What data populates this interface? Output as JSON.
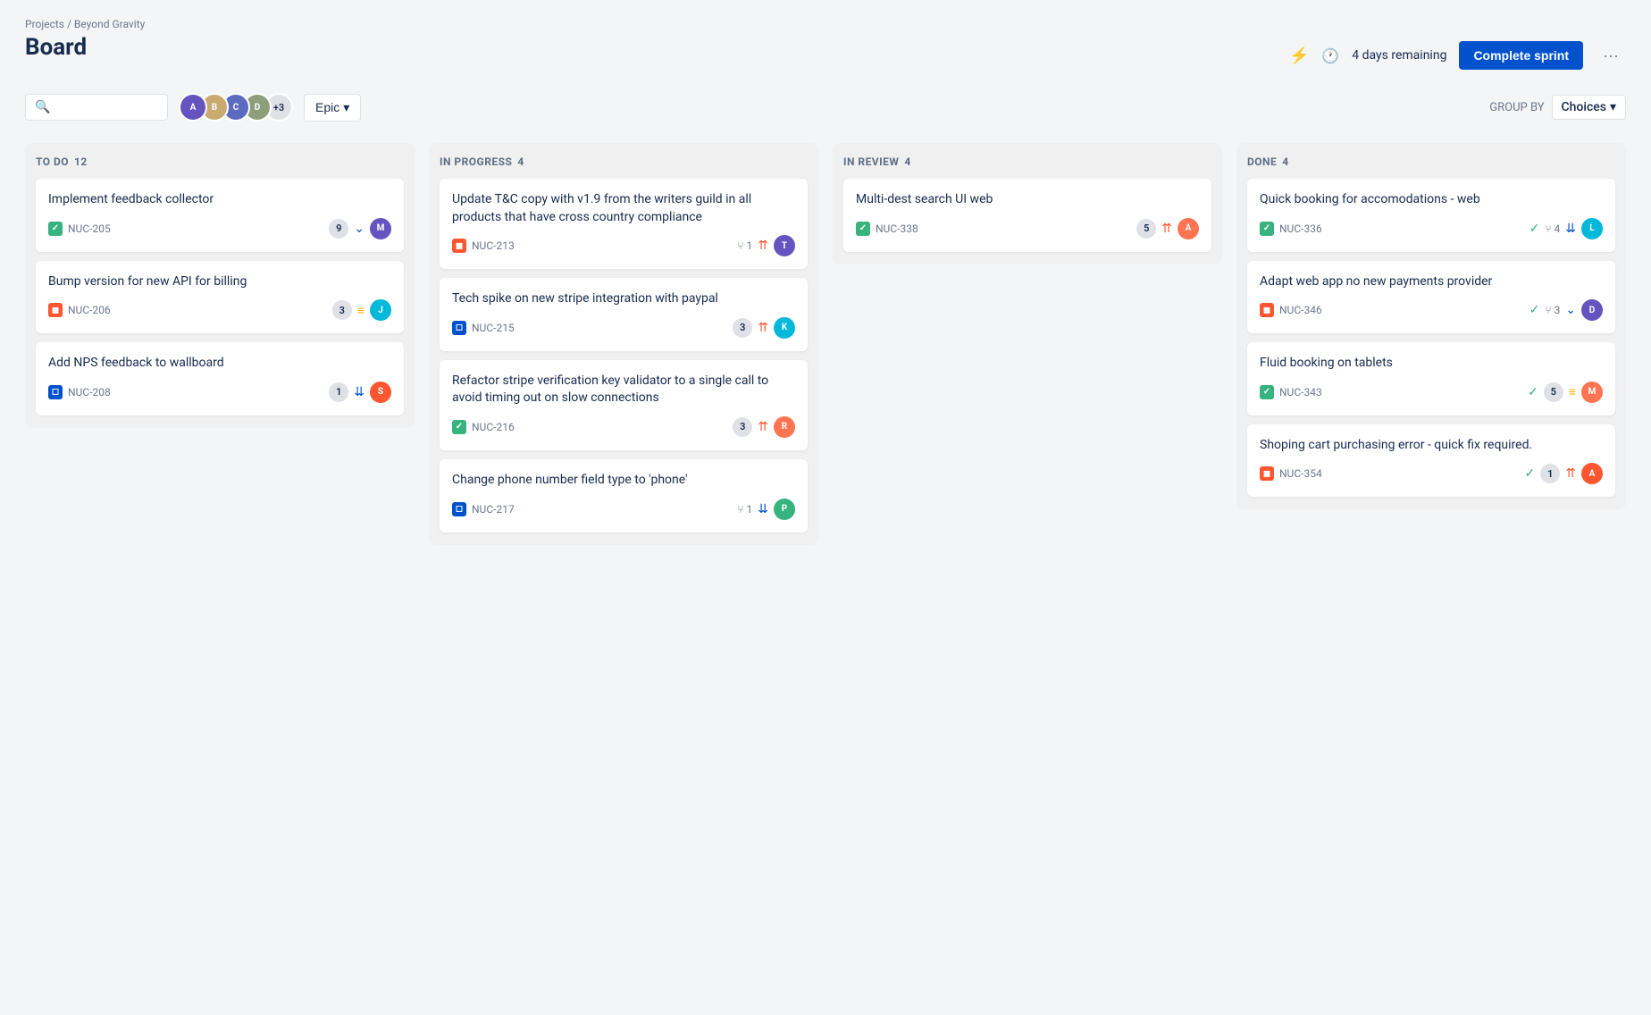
{
  "breadcrumb": "Projects / Beyond Gravity",
  "page_title": "Board",
  "search_placeholder": "",
  "avatars": [
    {
      "id": "av1",
      "initials": "A",
      "color": "#6554c0"
    },
    {
      "id": "av2",
      "initials": "B",
      "color": "#00b8d9"
    },
    {
      "id": "av3",
      "initials": "C",
      "color": "#ff7452"
    },
    {
      "id": "av4",
      "initials": "D",
      "color": "#36b37e"
    },
    {
      "id": "av5",
      "initials": "+3",
      "color": "#dfe1e6",
      "text_color": "#172b4d"
    }
  ],
  "epic_label": "Epic",
  "header": {
    "lightning_label": "",
    "days_remaining": "4 days remaining",
    "complete_sprint": "Complete sprint",
    "more": "···"
  },
  "group_by_label": "GROUP BY",
  "choices_label": "Choices",
  "columns": [
    {
      "id": "todo",
      "title": "TO DO",
      "count": "12",
      "cards": [
        {
          "id": "card-205",
          "title": "Implement feedback collector",
          "issue_type": "story",
          "issue_id": "NUC-205",
          "points": "9",
          "priority": "down",
          "priority_type": "low",
          "has_avatar": true,
          "avatar_color": "#6554c0",
          "avatar_initials": "M"
        },
        {
          "id": "card-206",
          "title": "Bump version for new API for billing",
          "issue_type": "bug",
          "issue_id": "NUC-206",
          "points": "3",
          "priority": "medium",
          "priority_type": "medium",
          "has_avatar": true,
          "avatar_color": "#00b8d9",
          "avatar_initials": "J"
        },
        {
          "id": "card-208",
          "title": "Add NPS feedback to wallboard",
          "issue_type": "task",
          "issue_id": "NUC-208",
          "points": "1",
          "priority": "double-down",
          "priority_type": "low2",
          "has_avatar": true,
          "avatar_color": "#ff5630",
          "avatar_initials": "S"
        }
      ]
    },
    {
      "id": "inprogress",
      "title": "IN PROGRESS",
      "count": "4",
      "cards": [
        {
          "id": "card-213",
          "title": "Update T&C copy with v1.9 from the writers guild in all products that have cross country compliance",
          "issue_type": "bug",
          "issue_id": "NUC-213",
          "has_pr": true,
          "pr_count": "1",
          "points": null,
          "priority": "high",
          "priority_type": "high",
          "has_avatar": true,
          "avatar_color": "#6554c0",
          "avatar_initials": "T"
        },
        {
          "id": "card-215",
          "title": "Tech spike on new stripe integration with paypal",
          "issue_type": "task",
          "issue_id": "NUC-215",
          "points": "3",
          "priority": "high",
          "priority_type": "high",
          "has_avatar": true,
          "avatar_color": "#00b8d9",
          "avatar_initials": "K"
        },
        {
          "id": "card-216",
          "title": "Refactor stripe verification key validator to a single call to avoid timing out on slow connections",
          "issue_type": "story",
          "issue_id": "NUC-216",
          "points": "3",
          "priority": "high",
          "priority_type": "high",
          "has_avatar": true,
          "avatar_color": "#ff7452",
          "avatar_initials": "R"
        },
        {
          "id": "card-217",
          "title": "Change phone number field type to 'phone'",
          "issue_type": "task",
          "issue_id": "NUC-217",
          "has_pr": true,
          "pr_count": "1",
          "points": null,
          "priority": "double-down",
          "priority_type": "low2",
          "has_avatar": true,
          "avatar_color": "#36b37e",
          "avatar_initials": "P"
        }
      ]
    },
    {
      "id": "inreview",
      "title": "IN REVIEW",
      "count": "4",
      "cards": [
        {
          "id": "card-338",
          "title": "Multi-dest search UI web",
          "issue_type": "story",
          "issue_id": "NUC-338",
          "points": "5",
          "priority": "high",
          "priority_type": "high",
          "has_avatar": true,
          "avatar_color": "#ff7452",
          "avatar_initials": "A"
        }
      ]
    },
    {
      "id": "done",
      "title": "DONE",
      "count": "4",
      "cards": [
        {
          "id": "card-336",
          "title": "Quick booking for accomodations - web",
          "issue_type": "story",
          "issue_id": "NUC-336",
          "has_check": true,
          "has_pr": true,
          "pr_count": "4",
          "points": null,
          "priority": "double-down",
          "priority_type": "low2",
          "has_avatar": true,
          "avatar_color": "#00b8d9",
          "avatar_initials": "L"
        },
        {
          "id": "card-346",
          "title": "Adapt web app no new payments provider",
          "issue_type": "bug",
          "issue_id": "NUC-346",
          "has_check": true,
          "has_pr": true,
          "pr_count": "3",
          "points": null,
          "priority": "down",
          "priority_type": "low",
          "has_avatar": true,
          "avatar_color": "#6554c0",
          "avatar_initials": "D"
        },
        {
          "id": "card-343",
          "title": "Fluid booking on tablets",
          "issue_type": "story",
          "issue_id": "NUC-343",
          "has_check": true,
          "points": "5",
          "priority": "medium",
          "priority_type": "medium",
          "has_avatar": true,
          "avatar_color": "#ff7452",
          "avatar_initials": "M"
        },
        {
          "id": "card-354",
          "title": "Shoping cart purchasing error - quick fix required.",
          "issue_type": "bug",
          "issue_id": "NUC-354",
          "has_check": true,
          "points": "1",
          "priority": "high",
          "priority_type": "high",
          "has_avatar": true,
          "avatar_color": "#ff5630",
          "avatar_initials": "A"
        }
      ]
    }
  ]
}
